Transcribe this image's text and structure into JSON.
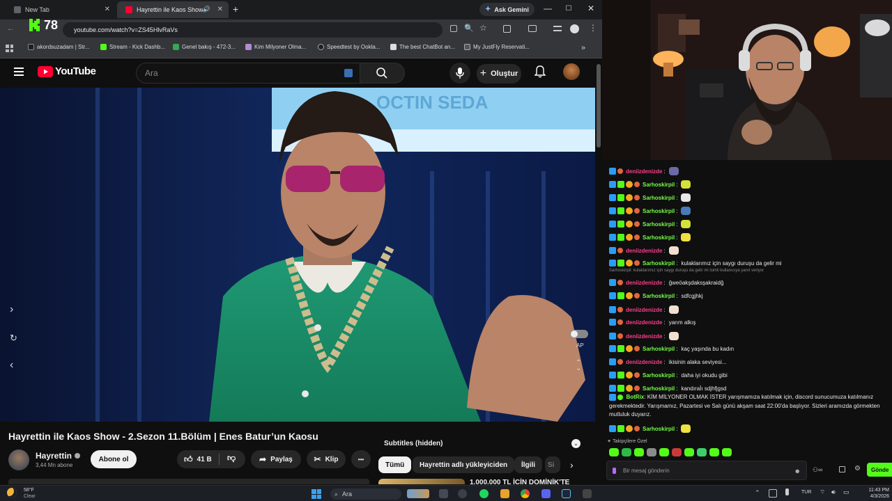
{
  "browser": {
    "tabs": [
      {
        "label": "New Tab"
      },
      {
        "label": "Hayrettin ile Kaos Show - 2."
      }
    ],
    "new_tab_symbol": "+",
    "gemini_label": "Ask Gemini",
    "url": "youtube.com/watch?v=ZS45HlvRaVs",
    "overlay_count": "78",
    "bookmarks": [
      {
        "label": "akordsuzadam | Str..."
      },
      {
        "label": "Stream - Kick Dashb..."
      },
      {
        "label": "Genel bakış - 472-3..."
      },
      {
        "label": "Kim Milyoner Olma..."
      },
      {
        "label": "Speedtest by Ookla..."
      },
      {
        "label": "The best ChatBot an..."
      },
      {
        "label": "My JustFly Reservati..."
      }
    ]
  },
  "youtube": {
    "logo_text": "YouTube",
    "search_placeholder": "Ara",
    "create_label": "Oluştur",
    "video_title": "Hayrettin ile Kaos Show - 2.Sezon 11.Bölüm | Enes Batur’un Kaosu",
    "channel_name": "Hayrettin",
    "subscribers": "3,44 Mn abone",
    "subscribe_label": "Abone ol",
    "likes": "41 B",
    "share_label": "Paylaş",
    "clip_label": "Klip",
    "more_label": "•••",
    "autoplay_label": "AP",
    "subtitles_label": "Subtitles (hidden)",
    "chips": [
      "Tümü",
      "Hayrettin adlı yükleyiciden",
      "İlgili",
      "Si"
    ],
    "next_video_title": "1.000.000 TL İÇİN DOMİNİK'TE"
  },
  "chat": {
    "messages": [
      {
        "user": "deniizdenizde",
        "text": "",
        "color": "pink",
        "emote": "#6a6aa8"
      },
      {
        "user": "Sarhoskirpil",
        "text": "",
        "color": "green",
        "emote": "#d4e23a"
      },
      {
        "user": "Sarhoskirpil",
        "text": "",
        "color": "green",
        "emote": "#e8e8e8"
      },
      {
        "user": "Sarhoskirpil",
        "text": "",
        "color": "green",
        "emote": "#4a7ab8"
      },
      {
        "user": "Sarhoskirpil",
        "text": "",
        "color": "green",
        "emote": "#d4e23a"
      },
      {
        "user": "Sarhoskirpil",
        "text": "",
        "color": "green",
        "emote": "#f0e040"
      },
      {
        "user": "deniizdenizde",
        "text": "",
        "color": "pink",
        "emote": "#f2dfcf"
      },
      {
        "user": "Sarhoskirpil",
        "text": "kulaklarımız için saygı duruşu da gelir mi",
        "color": "green",
        "emote": ""
      },
      {
        "user": "deniizdenizde",
        "text": "ğweöakşdaksşakraidğ",
        "color": "pink",
        "emote": ""
      },
      {
        "user": "Sarhoskirpil",
        "text": "sdfcgjhkj",
        "color": "green",
        "emote": ""
      },
      {
        "user": "deniizdenizde",
        "text": "",
        "color": "pink",
        "emote": "#f2dfcf"
      },
      {
        "user": "deniizdenizde",
        "text": "yarım alkış",
        "color": "pink",
        "emote": ""
      },
      {
        "user": "deniizdenizde",
        "text": "",
        "color": "pink",
        "emote": "#f2dfcf"
      },
      {
        "user": "Sarhoskirpil",
        "text": "kaç yaşında bu kadın",
        "color": "green",
        "emote": ""
      },
      {
        "user": "deniizdenizde",
        "text": "ikisinin alaka seviyesi...",
        "color": "pink",
        "emote": ""
      },
      {
        "user": "Sarhoskirpil",
        "text": "daha iyi okudu gibi",
        "color": "green",
        "emote": ""
      },
      {
        "user": "Sarhoskirpil",
        "text": "kandıraÌı sdjhfjgsd",
        "color": "green",
        "emote": ""
      }
    ],
    "reply_line": "Sarhoskirpil: kulaklarımız için saygı duruşu da gelir mi isimli kullanıcıya yanıt veriyor",
    "bot_user": "BotRix",
    "bot_text_1": "KİM MİLYONER OLMAK İSTER yarışmamıza katılmak için, discord sunucumuza katılmanız",
    "bot_text_2": "gerekmektedir. Yarışmamız, Pazartesi ve Salı günü akşam saat 22:00'da başlıyor. Sizleri aramızda görmekten",
    "bot_text_3": "mutluluk duyarız.",
    "last_user": "Sarhoskirpil",
    "followers_only": "Takipçilere Özel",
    "input_placeholder": "Bir mesaj gönderin",
    "send_label": "Gönde"
  },
  "taskbar": {
    "temperature": "58°F",
    "weather": "Clear",
    "search_label": "Ara",
    "language": "TUR",
    "time": "11:43 PM",
    "date": "4/3/2026"
  },
  "colors": {
    "youtube_red": "#ff0033",
    "kick_green": "#53fc18",
    "chat_pink": "#ff3d8b",
    "chat_green": "#75fd46"
  }
}
